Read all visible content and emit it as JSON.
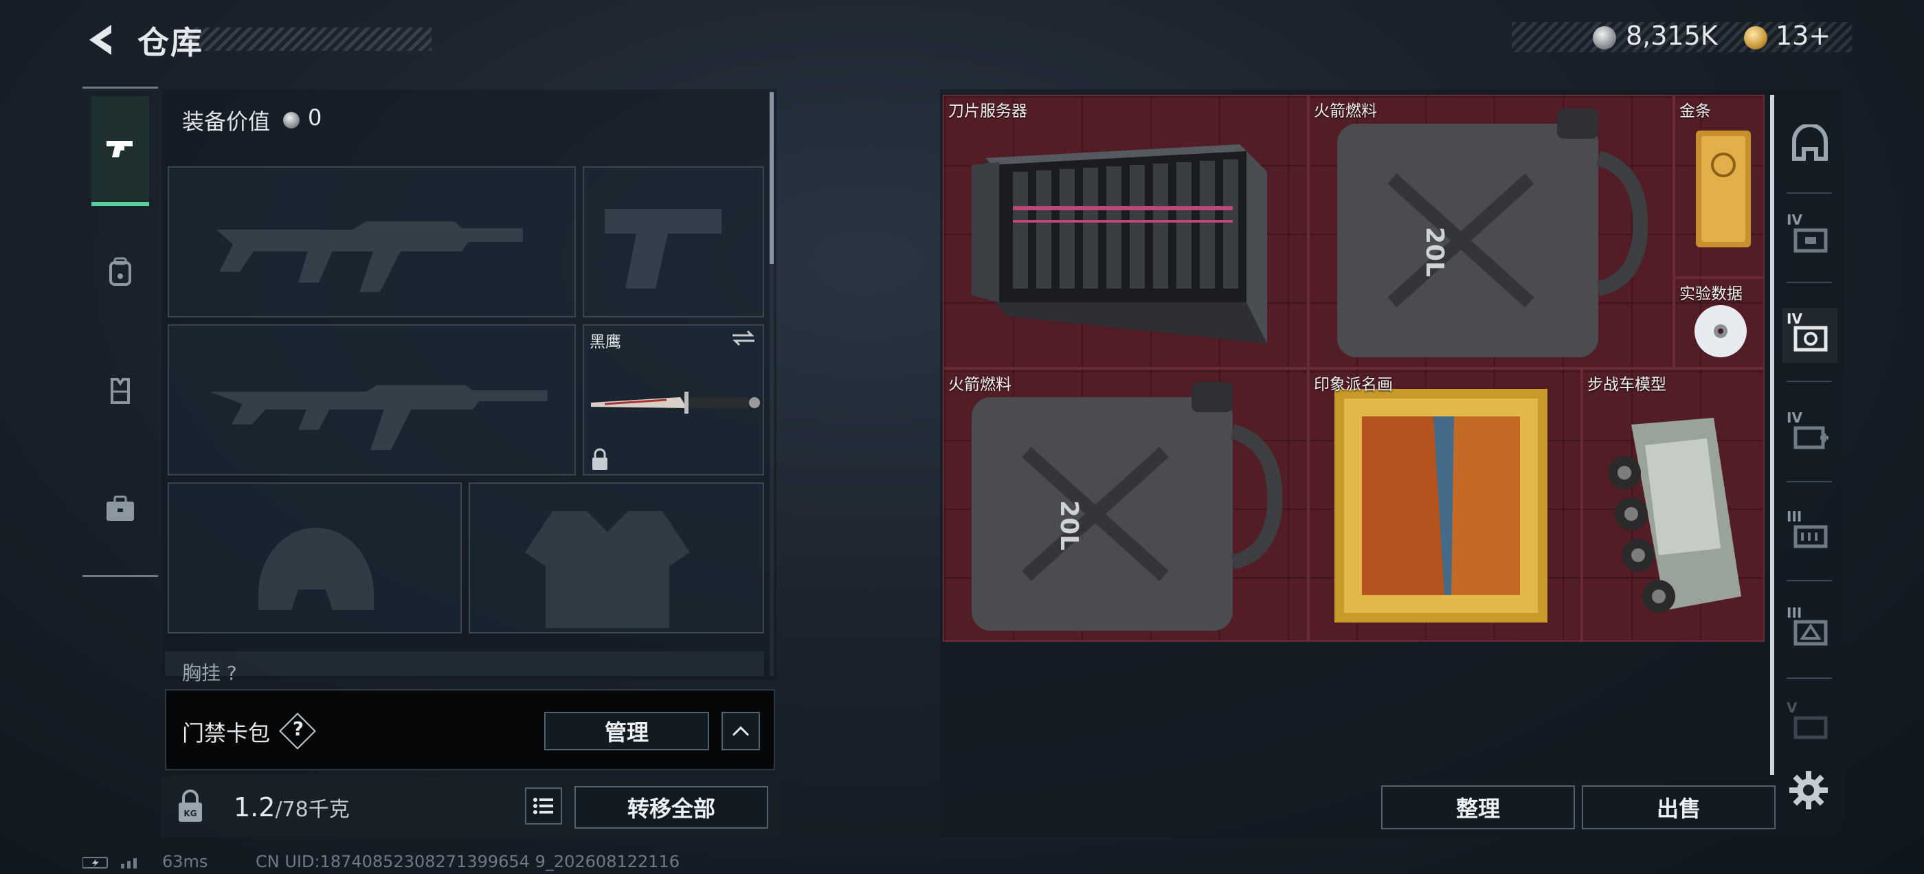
{
  "header": {
    "title": "仓库",
    "currency": {
      "silver": "8,315K",
      "gold": "13+"
    }
  },
  "loadout": {
    "equip_value_label": "装备价值",
    "equip_value": "0",
    "melee_slot_label": "黑鹰",
    "chest_label": "胸挂 ?"
  },
  "keycard": {
    "label": "门禁卡包",
    "help": "?",
    "manage_label": "管理"
  },
  "weight": {
    "current": "1.2",
    "max": "/78千克",
    "transfer_label": "转移全部"
  },
  "status": {
    "ping": "63ms",
    "uid": "CN UID:18740852308271399654 9_202608122116"
  },
  "storage": {
    "items": [
      {
        "name": "刀片服务器"
      },
      {
        "name": "火箭燃料"
      },
      {
        "name": "金条"
      },
      {
        "name": "实验数据"
      },
      {
        "name": "火箭燃料"
      },
      {
        "name": "印象派名画"
      },
      {
        "name": "步战车模型"
      }
    ],
    "fuel_can_print": "20L",
    "sort_label": "整理",
    "sell_label": "出售"
  },
  "right_tabs": [
    "IV",
    "IV",
    "IV",
    "III",
    "III",
    "V"
  ],
  "colors": {
    "accent": "#5ccf9f",
    "grid_bg": "#4a1c24",
    "panel": "#121a22"
  }
}
